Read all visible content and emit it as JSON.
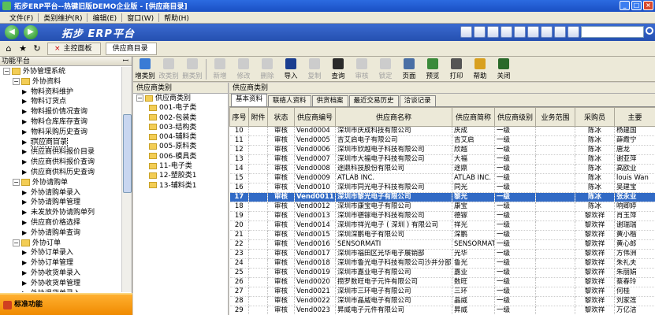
{
  "window": {
    "title": "拓步ERP平台--热键旧版DEMO企业版 - [供应商目录]",
    "btn_min": "_",
    "btn_max": "□",
    "btn_close": "×"
  },
  "menu": [
    "文件(F)",
    "类别维护(R)",
    "编辑(E)",
    "窗口(W)",
    "帮助(H)"
  ],
  "nav": {
    "brand": "拓步 ERP平台",
    "back_glyph": "◀",
    "forward_glyph": "▶"
  },
  "tabs": [
    {
      "label": "主控面板"
    },
    {
      "label": "供应商目录"
    }
  ],
  "left_panel": {
    "header": "功能平台",
    "pin_glyph": "ꟷ",
    "footer": "标准功能",
    "tree": [
      {
        "label": "外协管理系统",
        "level": 0,
        "type": "root",
        "toggle": "−"
      },
      {
        "label": "外协资料",
        "level": 1,
        "type": "folder",
        "toggle": "−"
      },
      {
        "label": "物料资料维护",
        "level": 2,
        "type": "item"
      },
      {
        "label": "物料订货点",
        "level": 2,
        "type": "item"
      },
      {
        "label": "物料报价情况查询",
        "level": 2,
        "type": "item"
      },
      {
        "label": "物料仓库库存查询",
        "level": 2,
        "type": "item"
      },
      {
        "label": "物料采购历史查询",
        "level": 2,
        "type": "item"
      },
      {
        "label": "供应商目录",
        "level": 2,
        "type": "item",
        "selected": true
      },
      {
        "label": "供应商供料报价目录",
        "level": 2,
        "type": "item"
      },
      {
        "label": "供应商供料报价查询",
        "level": 2,
        "type": "item"
      },
      {
        "label": "供应商供料历史查询",
        "level": 2,
        "type": "item"
      },
      {
        "label": "外协请购单",
        "level": 1,
        "type": "folder",
        "toggle": "−"
      },
      {
        "label": "外协请购单录入",
        "level": 2,
        "type": "item"
      },
      {
        "label": "外协请购单管理",
        "level": 2,
        "type": "item"
      },
      {
        "label": "未发放外协请购单列",
        "level": 2,
        "type": "item"
      },
      {
        "label": "供应商价格选择",
        "level": 2,
        "type": "item"
      },
      {
        "label": "外协请购单查询",
        "level": 2,
        "type": "item"
      },
      {
        "label": "外协订单",
        "level": 1,
        "type": "folder",
        "toggle": "−"
      },
      {
        "label": "外协订单录入",
        "level": 2,
        "type": "item"
      },
      {
        "label": "外协订单管理",
        "level": 2,
        "type": "item"
      },
      {
        "label": "外协收货单录入",
        "level": 2,
        "type": "item"
      },
      {
        "label": "外协收货单管理",
        "level": 2,
        "type": "item"
      },
      {
        "label": "外协退货单录入",
        "level": 2,
        "type": "item"
      },
      {
        "label": "外协退货单管理",
        "level": 2,
        "type": "item"
      }
    ]
  },
  "toolbar": [
    {
      "label": "增类别",
      "enabled": true,
      "color": "#3a7bd5"
    },
    {
      "label": "改类别",
      "enabled": false
    },
    {
      "label": "删类别",
      "enabled": false
    },
    {
      "sep": true
    },
    {
      "label": "新增",
      "enabled": false
    },
    {
      "label": "修改",
      "enabled": false
    },
    {
      "label": "删除",
      "enabled": false
    },
    {
      "label": "导入",
      "enabled": true,
      "color": "#1a3d8f"
    },
    {
      "label": "复制",
      "enabled": false
    },
    {
      "label": "查询",
      "enabled": true,
      "color": "#2a2a2a"
    },
    {
      "label": "审核",
      "enabled": false
    },
    {
      "label": "锁定",
      "enabled": false
    },
    {
      "label": "页面",
      "enabled": true,
      "color": "#4a6fa5"
    },
    {
      "label": "预览",
      "enabled": true,
      "color": "#3a8a3a"
    },
    {
      "label": "打印",
      "enabled": true,
      "color": "#555555"
    },
    {
      "label": "帮助",
      "enabled": true,
      "color": "#d8a020"
    },
    {
      "label": "关闭",
      "enabled": true,
      "color": "#2a6a2a"
    }
  ],
  "category_panel": {
    "header": "供应商类别",
    "root": "供应商类别",
    "items": [
      "001-电子类",
      "002-包装类",
      "003-结构类",
      "004-辅料类",
      "005-原料类",
      "006-模具类",
      "11-电子类",
      "12-塑胶类1",
      "13-辅料类1"
    ]
  },
  "main": {
    "header": "供应商类别",
    "subtabs": [
      "基本资料",
      "联络人资料",
      "供货档案",
      "最近交易历史",
      "洽谈记录"
    ],
    "columns": [
      "序号",
      "附件",
      "状态",
      "供应商编号",
      "供应商名称",
      "供应商简称",
      "供应商级别",
      "业务范围",
      "采购员",
      "主要"
    ],
    "rows": [
      [
        "10",
        "",
        "审核",
        "Vend0004",
        "深圳市庆成科技有限公司",
        "庆成",
        "一级",
        "",
        "陈冰",
        "杨建国"
      ],
      [
        "11",
        "",
        "审核",
        "Vend0005",
        "吉艾启电子有限公司",
        "吉艾启",
        "一级",
        "",
        "陈冰",
        "薛霞宁"
      ],
      [
        "12",
        "",
        "审核",
        "Vend0006",
        "深圳市欣越电子科技有限公司",
        "欣越",
        "一级",
        "",
        "陈冰",
        "唐龙"
      ],
      [
        "13",
        "",
        "审核",
        "Vend0007",
        "深圳市大福电子科技有限公司",
        "大福",
        "一级",
        "",
        "陈冰",
        "谢亚萍"
      ],
      [
        "14",
        "",
        "审核",
        "Vend0008",
        "途鼎科技股份有限公司",
        "途鼎",
        "一级",
        "",
        "陈冰",
        "高欧业"
      ],
      [
        "15",
        "",
        "审核",
        "Vend0009",
        "ATLAB INC.",
        "ATLAB INC.",
        "一级",
        "",
        "陈冰",
        "louis Wan"
      ],
      [
        "16",
        "",
        "审核",
        "Vend0010",
        "深圳市同光电子科技有限公司",
        "同光",
        "一级",
        "",
        "陈冰",
        "吴建宝"
      ],
      [
        "17",
        "",
        "审核",
        "Vend0011",
        "深圳市黎光电子有限公司",
        "黎光",
        "一级",
        "",
        "陈冰",
        "张永业"
      ],
      [
        "18",
        "",
        "审核",
        "Vend0012",
        "深圳市康宝电子有限公司",
        "康宝",
        "一级",
        "",
        "陈冰",
        "响卿婷"
      ],
      [
        "19",
        "",
        "审核",
        "Vend0013",
        "深圳市德镓电子科技有限公司",
        "德镓",
        "一级",
        "",
        "黎欢祥",
        "肖玉萍"
      ],
      [
        "20",
        "",
        "审核",
        "Vend0014",
        "深圳市祥光电子 ( 深圳 ) 有限公司",
        "祥光",
        "一级",
        "",
        "黎欢祥",
        "谢瑞瑞"
      ],
      [
        "21",
        "",
        "审核",
        "Vend0015",
        "深圳深鹏电子有限公司",
        "深鹏",
        "一级",
        "",
        "黎欢祥",
        "黄小楷"
      ],
      [
        "22",
        "",
        "审核",
        "Vend0016",
        "SENSORMATI",
        "SENSORMATI",
        "一级",
        "",
        "黎欢祥",
        "黄心郎"
      ],
      [
        "23",
        "",
        "审核",
        "Vend0017",
        "深圳市福田区光华电子展销部",
        "光华",
        "一级",
        "",
        "黎欢祥",
        "方伟洲"
      ],
      [
        "24",
        "",
        "审核",
        "Vend0018",
        "深圳市鲁光电子科技有限公司沙井分部",
        "鲁光",
        "一级",
        "",
        "黎欢祥",
        "朱礼夫"
      ],
      [
        "25",
        "",
        "审核",
        "Vend0019",
        "深圳市嘉业电子有限公司",
        "嘉业",
        "一级",
        "",
        "黎欢祥",
        "朱丽娟"
      ],
      [
        "26",
        "",
        "审核",
        "Vend0020",
        "攒罗数旺电子元件有限公司",
        "数旺",
        "一级",
        "",
        "黎欢祥",
        "蔡春玲"
      ],
      [
        "27",
        "",
        "审核",
        "Vend0021",
        "深圳市三环电子有限公司",
        "三环",
        "一级",
        "",
        "黎欢祥",
        "何桂"
      ],
      [
        "28",
        "",
        "审核",
        "Vend0022",
        "深圳市晶威电子有限公司",
        "晶威",
        "一级",
        "",
        "黎欢祥",
        "刘家莲"
      ],
      [
        "29",
        "",
        "审核",
        "Vend0023",
        "昇威电子元件有限公司",
        "昇威",
        "一级",
        "",
        "黎欢祥",
        "万亿洁"
      ],
      [
        "30",
        "",
        "审核",
        "Vend0024",
        "乐清市科达电子有限公司",
        "科达",
        "一级",
        "",
        "黎欢祥",
        "徐钰强"
      ]
    ],
    "selected_row": 7
  }
}
